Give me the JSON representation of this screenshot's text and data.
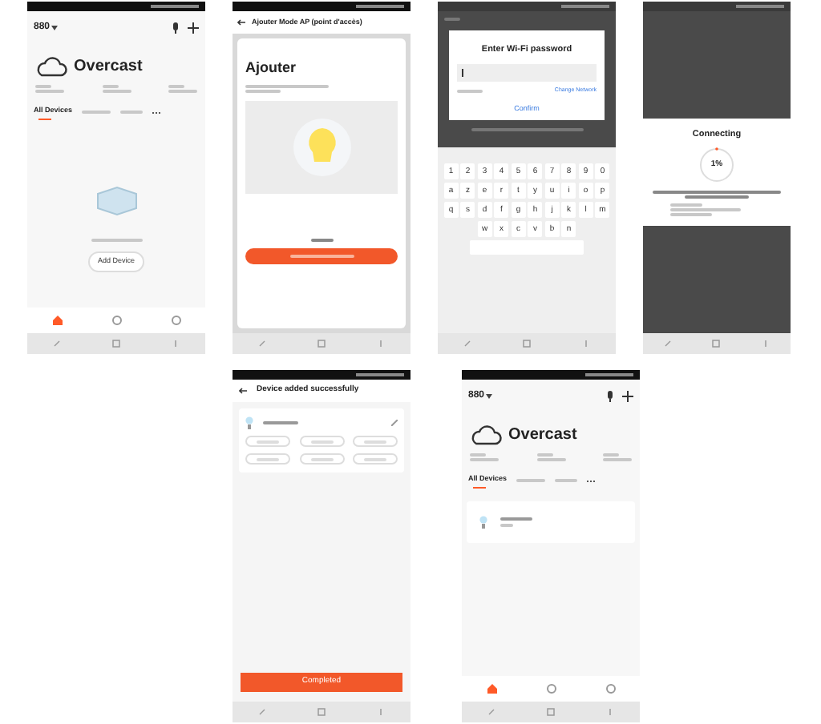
{
  "screens": [
    {
      "kind": "home",
      "location": "880",
      "weather": "Overcast",
      "tabs": [
        {
          "label": "All Devices",
          "selected": true
        }
      ],
      "empty_button": "Add Device",
      "nav": [
        {
          "selected": true
        },
        {
          "selected": false
        },
        {
          "selected": false
        }
      ]
    },
    {
      "kind": "ap_mode",
      "header": "Ajouter Mode AP (point d'accès)",
      "title": "Ajouter"
    },
    {
      "kind": "wifi",
      "dialog_title": "Enter Wi-Fi password",
      "link": "Change Network",
      "confirm": "Confirm",
      "keys": [
        [
          "1",
          "2",
          "3",
          "4",
          "5",
          "6",
          "7",
          "8",
          "9",
          "0"
        ],
        [
          "a",
          "z",
          "e",
          "r",
          "t",
          "y",
          "u",
          "i",
          "o",
          "p"
        ],
        [
          "q",
          "s",
          "d",
          "f",
          "g",
          "h",
          "j",
          "k",
          "l",
          "m"
        ],
        [
          "w",
          "x",
          "c",
          "v",
          "b",
          "n"
        ]
      ]
    },
    {
      "kind": "connecting",
      "title": "Connecting",
      "progress": "1%"
    },
    {
      "kind": "added",
      "header": "Device added successfully",
      "button": "Completed"
    },
    {
      "kind": "home",
      "location": "880",
      "weather": "Overcast",
      "tabs": [
        {
          "label": "All Devices",
          "selected": true
        }
      ],
      "devices": [
        {
          "kind": "bulb"
        }
      ],
      "nav": [
        {
          "selected": true
        },
        {
          "selected": false
        },
        {
          "selected": false
        }
      ]
    }
  ]
}
